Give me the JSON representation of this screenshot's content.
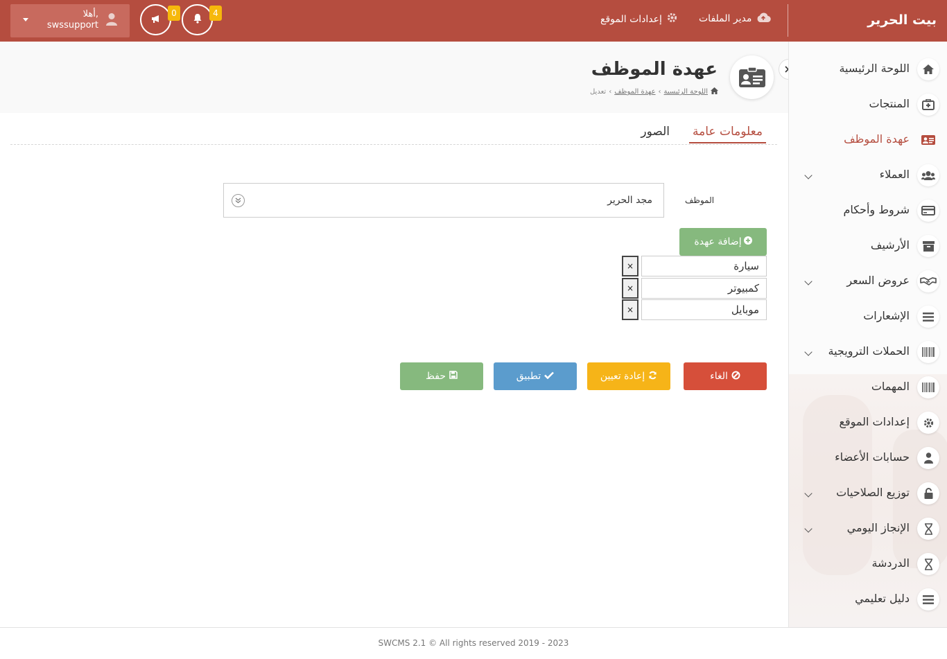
{
  "brand": {
    "title": "بيت الحرير"
  },
  "topbar": {
    "file_manager": "مدير الملفات",
    "site_settings": "إعدادات الموقع",
    "user_greeting": "أهلا,",
    "username": "swssupport",
    "notifications_count": "4",
    "announcements_count": "0"
  },
  "sidebar": {
    "items": [
      {
        "label": "اللوحة الرئيسية",
        "icon": "home-icon"
      },
      {
        "label": "المنتجات",
        "icon": "briefcase-medical-icon"
      },
      {
        "label": "عهدة الموظف",
        "icon": "id-card-icon",
        "active": true
      },
      {
        "label": "العملاء",
        "icon": "users-icon",
        "submenu": true
      },
      {
        "label": "شروط وأحكام",
        "icon": "credit-card-icon"
      },
      {
        "label": "الأرشيف",
        "icon": "archive-icon"
      },
      {
        "label": "عروض السعر",
        "icon": "handshake-icon",
        "submenu": true
      },
      {
        "label": "الإشعارات",
        "icon": "bars-icon"
      },
      {
        "label": "الحملات الترويجية",
        "icon": "barcode-icon",
        "submenu": true
      },
      {
        "label": "المهمات",
        "icon": "barcode-icon"
      },
      {
        "label": "إعدادات الموقع",
        "icon": "gear-icon"
      },
      {
        "label": "حسابات الأعضاء",
        "icon": "user-icon"
      },
      {
        "label": "توزيع الصلاحيات",
        "icon": "unlock-icon",
        "submenu": true
      },
      {
        "label": "الإنجاز اليومي",
        "icon": "hourglass-icon",
        "submenu": true
      },
      {
        "label": "الدردشة",
        "icon": "hourglass-icon"
      },
      {
        "label": "دليل تعليمي",
        "icon": "bars-icon"
      }
    ]
  },
  "page": {
    "title": "عهدة الموظف",
    "breadcrumb": {
      "home": "اللوحة الرئيسية",
      "section": "عهدة الموظف",
      "current": "تعديل"
    }
  },
  "tabs": {
    "general": "معلومات عامة",
    "images": "الصور"
  },
  "form": {
    "employee_label": "الموظف",
    "employee_value": "مجد الحرير",
    "add_custody_label": "إضافة عهدة",
    "custody_items": [
      "سيارة",
      "كمبيوتر",
      "موبايل"
    ],
    "remove_symbol": "×"
  },
  "actions": {
    "cancel": "الغاء",
    "reset": "إعادة تعيين",
    "apply": "تطبيق",
    "save": "حفظ"
  },
  "footer": {
    "text": "SWCMS 2.1 © All rights reserved 2019 - 2023"
  },
  "colors": {
    "brand": "#b54d3f",
    "success": "#86b97e",
    "warning": "#f6b418",
    "info": "#5b9ccd",
    "danger": "#d64f3a",
    "badge": "#f6b80c"
  }
}
